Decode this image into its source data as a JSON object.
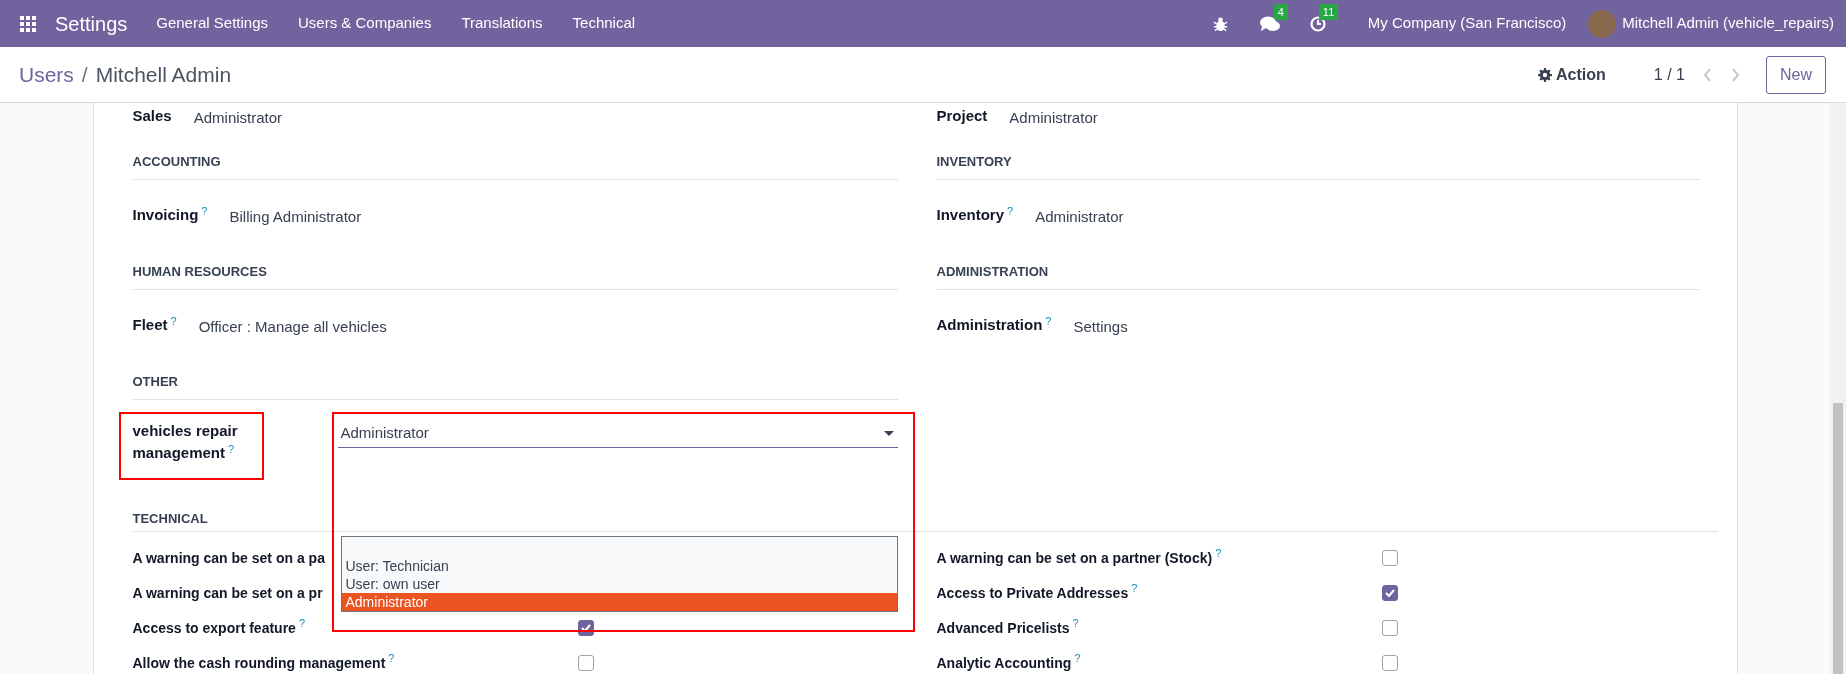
{
  "navbar": {
    "app_name": "Settings",
    "menu": [
      "General Settings",
      "Users & Companies",
      "Translations",
      "Technical"
    ],
    "messages_badge": "4",
    "activities_badge": "11",
    "company": "My Company (San Francisco)",
    "user": "Mitchell Admin (vehicle_repairs)"
  },
  "control_panel": {
    "breadcrumb": [
      {
        "label": "Users",
        "kind": "link"
      },
      {
        "label": "Mitchell Admin",
        "kind": "current"
      }
    ],
    "separator": "/",
    "action": "Action",
    "pager": "1 / 1",
    "new_button": "New"
  },
  "groups": [
    {
      "left": {
        "fields": [
          {
            "label": "Sales",
            "value": "Administrator",
            "kind": "text"
          }
        ]
      },
      "right": {
        "fields": [
          {
            "label": "Project",
            "value": "Administrator",
            "kind": "text"
          }
        ]
      }
    },
    {
      "left": {
        "title": "ACCOUNTING",
        "fields": [
          {
            "label": "Invoicing",
            "help": "?",
            "value": "Billing Administrator",
            "kind": "text"
          }
        ]
      },
      "right": {
        "title": "INVENTORY",
        "fields": [
          {
            "label": "Inventory",
            "help": "?",
            "value": "Administrator",
            "kind": "text"
          }
        ]
      }
    },
    {
      "left": {
        "title": "HUMAN RESOURCES",
        "fields": [
          {
            "label": "Fleet",
            "help": "?",
            "value": "Officer : Manage all vehicles",
            "kind": "text"
          }
        ]
      },
      "right": {
        "title": "ADMINISTRATION",
        "fields": [
          {
            "label": "Administration",
            "help": "?",
            "value": "Settings",
            "kind": "text"
          }
        ]
      }
    },
    {
      "left": {
        "title": "OTHER",
        "fields": [
          {
            "label": "vehicles repair management",
            "help": "?",
            "value": "Administrator",
            "kind": "select",
            "annotated": true,
            "options": [
              {
                "label": "User: Technician",
                "selected": false
              },
              {
                "label": "User: own user",
                "selected": false
              },
              {
                "label": "Administrator",
                "selected": true
              }
            ]
          }
        ]
      }
    }
  ],
  "technical": {
    "title": "TECHNICAL",
    "left": [
      {
        "label": "A warning can be set on a pa"
      },
      {
        "label": "A warning can be set on a pr"
      },
      {
        "label": "Access to export feature",
        "help": "?",
        "checked": true
      },
      {
        "label": "Allow the cash rounding management",
        "help": "?",
        "checked": false
      }
    ],
    "right": [
      {
        "label": "A warning can be set on a partner (Stock)",
        "help": "?",
        "checked": false
      },
      {
        "label": "Access to Private Addresses",
        "help": "?",
        "checked": true
      },
      {
        "label": "Advanced Pricelists",
        "help": "?",
        "checked": false
      },
      {
        "label": "Analytic Accounting",
        "help": "?",
        "checked": false
      }
    ]
  }
}
